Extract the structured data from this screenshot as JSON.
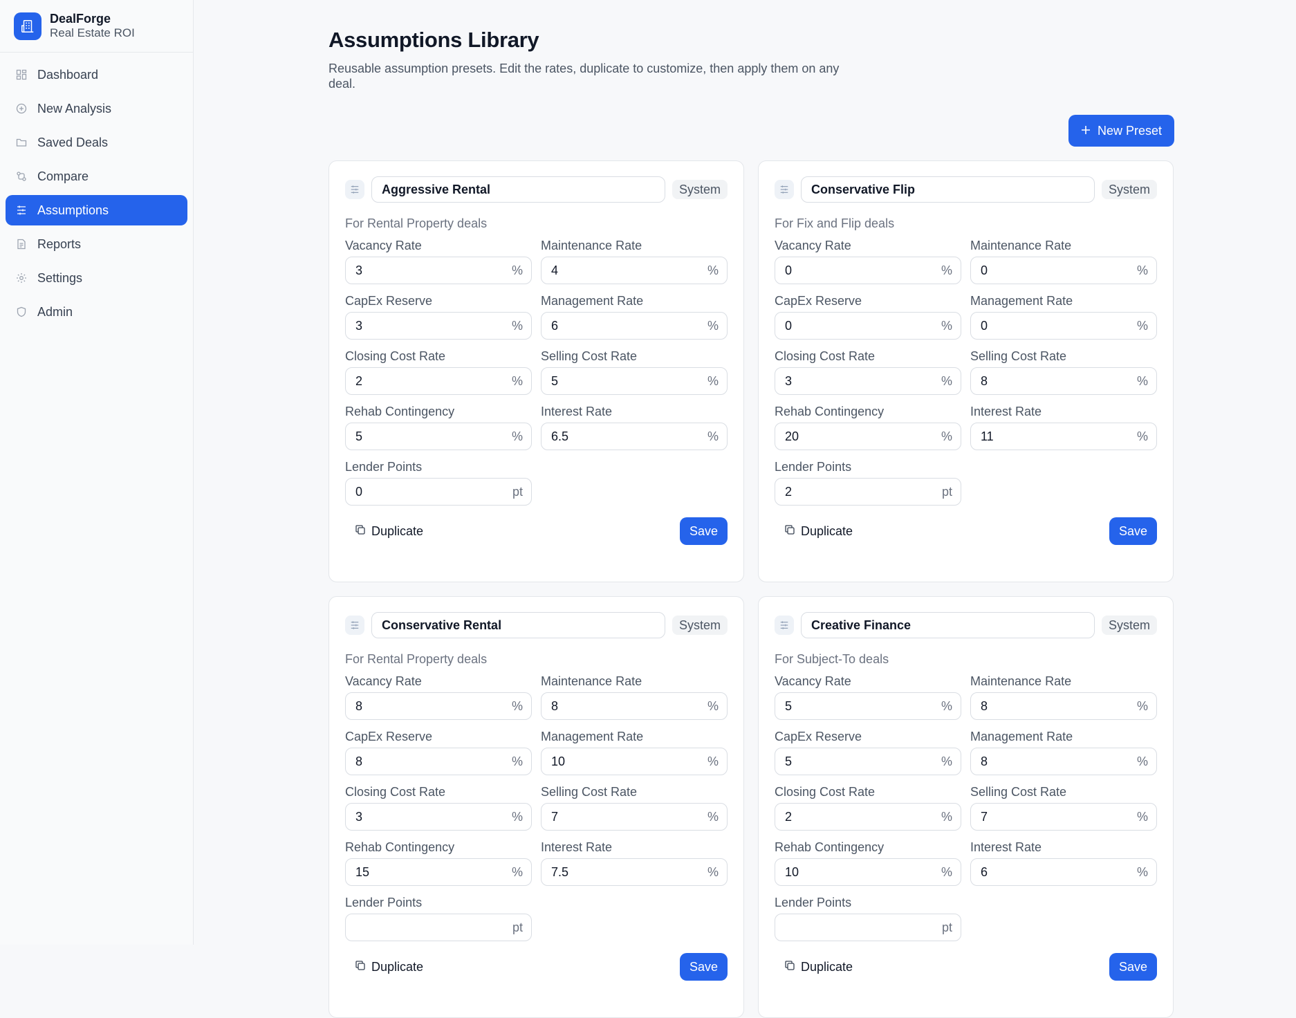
{
  "brand": {
    "name": "DealForge",
    "subtitle": "Real Estate ROI"
  },
  "sidebar": {
    "items": [
      {
        "label": "Dashboard",
        "icon": "grid-icon",
        "active": false
      },
      {
        "label": "New Analysis",
        "icon": "plus-circle-icon",
        "active": false
      },
      {
        "label": "Saved Deals",
        "icon": "folder-icon",
        "active": false
      },
      {
        "label": "Compare",
        "icon": "compare-icon",
        "active": false
      },
      {
        "label": "Assumptions",
        "icon": "sliders-icon",
        "active": true
      },
      {
        "label": "Reports",
        "icon": "document-icon",
        "active": false
      },
      {
        "label": "Settings",
        "icon": "gear-icon",
        "active": false
      },
      {
        "label": "Admin",
        "icon": "shield-icon",
        "active": false
      }
    ]
  },
  "header": {
    "title": "Assumptions Library",
    "subtitle": "Reusable assumption presets. Edit the rates, duplicate to customize, then apply them on any deal."
  },
  "toolbar": {
    "new_preset_label": "New Preset",
    "new_preset_icon": "plus-icon"
  },
  "labels": {
    "vacancy": "Vacancy Rate",
    "maintenance": "Maintenance Rate",
    "capex": "CapEx Reserve",
    "management": "Management Rate",
    "closing": "Closing Cost Rate",
    "selling": "Selling Cost Rate",
    "rehab": "Rehab Contingency",
    "interest": "Interest Rate",
    "points": "Lender Points",
    "percent_unit": "%",
    "points_unit": "pt",
    "duplicate": "Duplicate",
    "save": "Save"
  },
  "presets": [
    {
      "name": "Aggressive Rental",
      "badge": "System",
      "deal_type": "For Rental Property deals",
      "vacancy": "3",
      "maintenance": "4",
      "capex": "3",
      "management": "6",
      "closing": "2",
      "selling": "5",
      "rehab": "5",
      "interest": "6.5",
      "points": "0"
    },
    {
      "name": "Conservative Flip",
      "badge": "System",
      "deal_type": "For Fix and Flip deals",
      "vacancy": "0",
      "maintenance": "0",
      "capex": "0",
      "management": "0",
      "closing": "3",
      "selling": "8",
      "rehab": "20",
      "interest": "11",
      "points": "2"
    },
    {
      "name": "Conservative Rental",
      "badge": "System",
      "deal_type": "For Rental Property deals",
      "vacancy": "8",
      "maintenance": "8",
      "capex": "8",
      "management": "10",
      "closing": "3",
      "selling": "7",
      "rehab": "15",
      "interest": "7.5",
      "points": ""
    },
    {
      "name": "Creative Finance",
      "badge": "System",
      "deal_type": "For Subject-To deals",
      "vacancy": "5",
      "maintenance": "8",
      "capex": "5",
      "management": "8",
      "closing": "2",
      "selling": "7",
      "rehab": "10",
      "interest": "6",
      "points": ""
    }
  ],
  "colors": {
    "accent": "#2563eb",
    "sidebar_bg": "#f9fafb",
    "page_bg": "#f7f8fa"
  }
}
